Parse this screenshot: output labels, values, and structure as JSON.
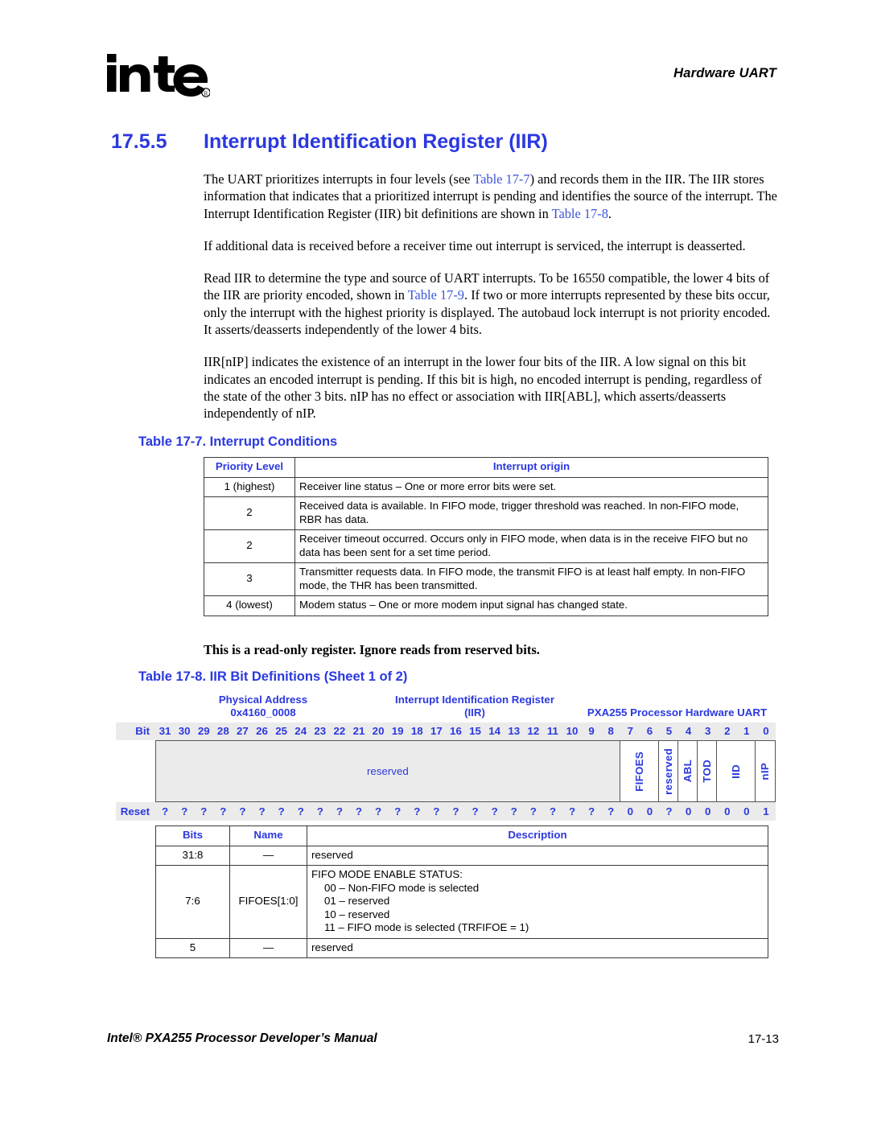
{
  "header": {
    "running_head": "Hardware UART",
    "logo_alt": "intel",
    "logo_registered": "®"
  },
  "section": {
    "number": "17.5.5",
    "title": "Interrupt Identification Register (IIR)"
  },
  "paragraphs": [
    {
      "runs": [
        {
          "t": "The UART prioritizes interrupts in four levels (see "
        },
        {
          "t": "Table 17-7",
          "link": true
        },
        {
          "t": ") and records them in the IIR. The IIR stores information that indicates that a prioritized interrupt is pending and identifies the source of the interrupt. The Interrupt Identification Register (IIR) bit definitions are shown in "
        },
        {
          "t": "Table 17-8",
          "link": true
        },
        {
          "t": "."
        }
      ]
    },
    {
      "runs": [
        {
          "t": "If additional data is received before a receiver time out interrupt is serviced, the interrupt is deasserted."
        }
      ]
    },
    {
      "runs": [
        {
          "t": "Read IIR to determine the type and source of UART interrupts. To be 16550 compatible, the lower 4 bits of the IIR are priority encoded, shown in "
        },
        {
          "t": "Table 17-9",
          "link": true
        },
        {
          "t": ". If two or more interrupts represented by these bits occur, only the interrupt with the highest priority is displayed. The autobaud lock interrupt is not priority encoded. It asserts/deasserts independently of the lower 4 bits."
        }
      ]
    },
    {
      "runs": [
        {
          "t": "IIR[nIP] indicates the existence of an interrupt in the lower four bits of the IIR. A low signal on this bit indicates an encoded interrupt is pending. If this bit is high, no encoded interrupt is pending, regardless of the state of the other 3 bits. nIP has no effect or association with IIR[ABL], which asserts/deasserts independently of nIP."
        }
      ]
    }
  ],
  "table_17_7": {
    "caption": "Table 17-7. Interrupt Conditions",
    "columns": [
      "Priority Level",
      "Interrupt origin"
    ],
    "rows": [
      [
        "1 (highest)",
        "Receiver line status – One or more error bits were set."
      ],
      [
        "2",
        "Received data is available. In FIFO mode, trigger threshold was reached. In non-FIFO mode, RBR has data."
      ],
      [
        "2",
        "Receiver timeout occurred. Occurs only in FIFO mode, when data is in the receive FIFO but no data has been sent for a set time period."
      ],
      [
        "3",
        "Transmitter requests data. In FIFO mode, the transmit FIFO is at least half empty. In non-FIFO mode, the THR has been transmitted."
      ],
      [
        "4 (lowest)",
        "Modem status – One or more modem input signal has changed state."
      ]
    ]
  },
  "note": "This is a read-only register. Ignore reads from reserved bits.",
  "table_17_8": {
    "caption": "Table 17-8. IIR Bit Definitions (Sheet 1 of 2)",
    "register_header": {
      "address_label": "Physical Address",
      "address_value": "0x4160_0008",
      "register_name": "Interrupt Identification Register",
      "register_abbrev": "(IIR)",
      "unit": "PXA255 Processor Hardware UART"
    },
    "bit_row_label": "Bit",
    "reset_row_label": "Reset",
    "bit_numbers": [
      "31",
      "30",
      "29",
      "28",
      "27",
      "26",
      "25",
      "24",
      "23",
      "22",
      "21",
      "20",
      "19",
      "18",
      "17",
      "16",
      "15",
      "14",
      "13",
      "12",
      "11",
      "10",
      "9",
      "8",
      "7",
      "6",
      "5",
      "4",
      "3",
      "2",
      "1",
      "0"
    ],
    "fields": [
      {
        "name": "reserved",
        "span": 24,
        "orientation": "horizontal",
        "shaded": true
      },
      {
        "name": "FIFOES",
        "span": 2,
        "orientation": "vertical",
        "shaded": false
      },
      {
        "name": "reserved",
        "span": 1,
        "orientation": "vertical",
        "shaded": false
      },
      {
        "name": "ABL",
        "span": 1,
        "orientation": "vertical",
        "shaded": false
      },
      {
        "name": "TOD",
        "span": 1,
        "orientation": "vertical",
        "shaded": false
      },
      {
        "name": "IID",
        "span": 2,
        "orientation": "vertical",
        "shaded": false
      },
      {
        "name": "nIP",
        "span": 1,
        "orientation": "vertical",
        "shaded": false
      }
    ],
    "reset_values": [
      "?",
      "?",
      "?",
      "?",
      "?",
      "?",
      "?",
      "?",
      "?",
      "?",
      "?",
      "?",
      "?",
      "?",
      "?",
      "?",
      "?",
      "?",
      "?",
      "?",
      "?",
      "?",
      "?",
      "?",
      "0",
      "0",
      "?",
      "0",
      "0",
      "0",
      "0",
      "1"
    ],
    "desc_columns": [
      "Bits",
      "Name",
      "Description"
    ],
    "desc_rows": [
      {
        "bits": "31:8",
        "name": "—",
        "lines": [
          {
            "text": "reserved",
            "indent": false
          }
        ]
      },
      {
        "bits": "7:6",
        "name": "FIFOES[1:0]",
        "lines": [
          {
            "text": "FIFO MODE ENABLE STATUS:",
            "indent": false
          },
          {
            "text": "00 – Non-FIFO mode is selected",
            "indent": true
          },
          {
            "text": "01 – reserved",
            "indent": true
          },
          {
            "text": "10 – reserved",
            "indent": true
          },
          {
            "text": "11 – FIFO mode is selected (TRFIFOE = 1)",
            "indent": true
          }
        ]
      },
      {
        "bits": "5",
        "name": "—",
        "lines": [
          {
            "text": "reserved",
            "indent": false
          }
        ]
      }
    ]
  },
  "footer": {
    "document_title": "Intel® PXA255 Processor Developer’s Manual",
    "page_number": "17-13"
  },
  "colors": {
    "accent_blue": "#2B38E0",
    "link_blue": "#3B54D8",
    "shade_gray": "#ebebeb",
    "rule_gray": "#3a3a3a"
  }
}
